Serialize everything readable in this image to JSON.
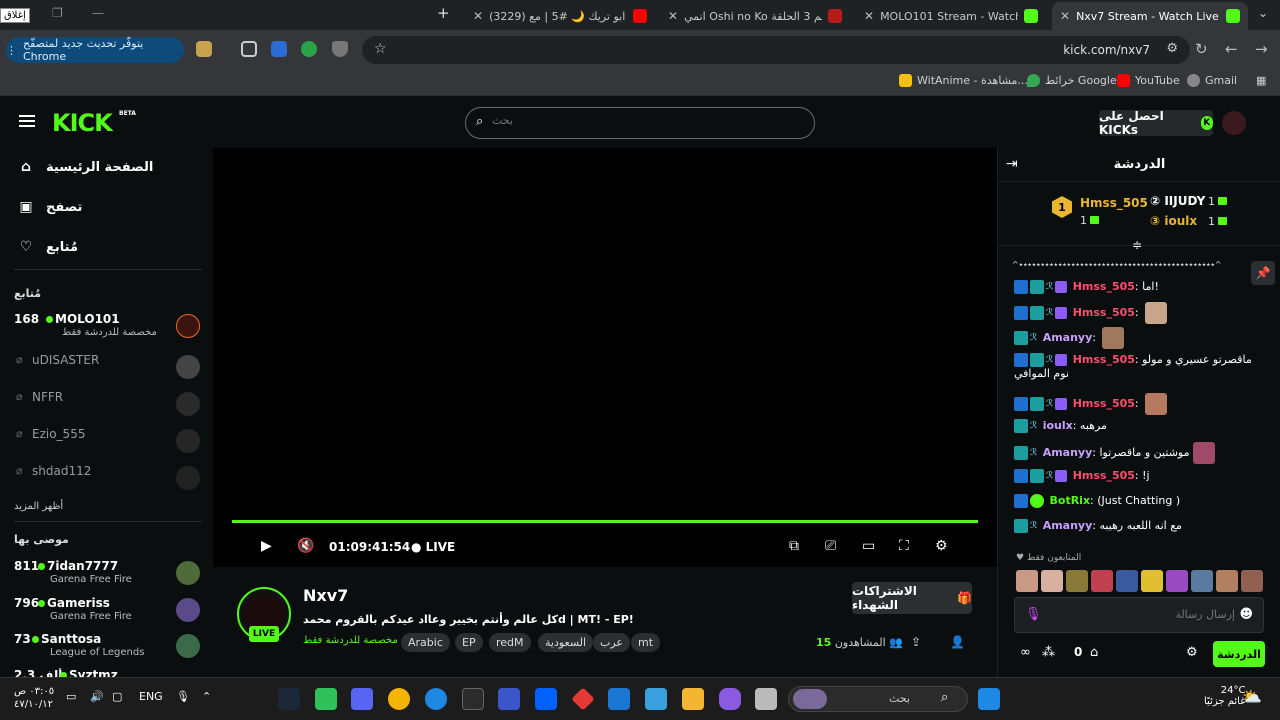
{
  "browser": {
    "tabs": [
      {
        "label": "Nxv7 Stream - Watch Live on Kick",
        "active": true,
        "color": "#53fc18"
      },
      {
        "label": "MOLO101 Stream - Watch Live",
        "color": "#53fc18"
      },
      {
        "label": "انمي Oshi no Ko الموسم 3 الحلقة",
        "color": "#e53935"
      },
      {
        "label": "(3229) سمرة ابو تريك 🌙 #5 | مع",
        "color": "#ff0000"
      }
    ],
    "close_tooltip": "إغلاق",
    "update_pill": "يتوفّر تحديث جديد لمتصفّح Chrome",
    "url": "kick.com/nxv7",
    "bookmarks": [
      {
        "label": "Gmail",
        "color": "#ea4335"
      },
      {
        "label": "YouTube",
        "color": "#ff0000"
      },
      {
        "label": "خرائط Google",
        "color": "#34a853"
      },
      {
        "label": "WitAnime - مشاهدة...",
        "color": "#f4c20d"
      }
    ]
  },
  "kick": {
    "logo": "KICK",
    "beta": "BETA",
    "search_placeholder": "بحث",
    "get_kicks": "احصل على KICKs",
    "nav": [
      {
        "label": "الصفحة الرئيسية",
        "icon": "home-icon"
      },
      {
        "label": "تصفح",
        "icon": "browse-icon"
      },
      {
        "label": "مُتابع",
        "icon": "heart-icon"
      }
    ],
    "following_title": "مُتابع",
    "following": [
      {
        "name": "MOLO101",
        "count": "168",
        "sub": "مخصصة للدردشة فقط",
        "live": true
      },
      {
        "name": "uDISASTER",
        "live": false
      },
      {
        "name": "NFFR",
        "live": false
      },
      {
        "name": "Ezio_555",
        "live": false
      },
      {
        "name": "shdad112",
        "live": false
      }
    ],
    "show_more": "أظهر المزيد",
    "recommended_title": "موصى بها",
    "recommended": [
      {
        "name": "7idan7777",
        "count": "811",
        "sub": "Garena Free Fire"
      },
      {
        "name": "Gameriss",
        "count": "796",
        "sub": "Garena Free Fire"
      },
      {
        "name": "Santtosa",
        "count": "73",
        "sub": "League of Legends"
      },
      {
        "name": "Syztmz",
        "count": "2.3 ألف",
        "sub": ""
      }
    ],
    "player": {
      "time": "01:09:41:54",
      "live": "LIVE",
      "progress": 1.0
    },
    "stream": {
      "streamer": "Nxv7",
      "live_badge": "LIVE",
      "title": "كل عالم وأنتم بخيير وعااد عيدكم بالقروم محمدd | MT! - EP!",
      "category": "مخصصة للدردشة فقط",
      "tags": [
        "Arabic",
        "EP",
        "redM",
        "السعودية",
        "عرب",
        "mt"
      ],
      "subs_button": "الاشتراكات الشهداء",
      "viewers_label": "المشاهدون",
      "viewers": "15"
    },
    "chat": {
      "header": "الدردشة",
      "leaderboard": [
        {
          "rank": "1",
          "name": "Hmss_505",
          "count": "1",
          "color": "#e8b630"
        },
        {
          "rank": "2",
          "name": "IIJUDY",
          "count": "1",
          "color": "#ffffff"
        },
        {
          "rank": "3",
          "name": "ioulx",
          "count": "1",
          "color": "#e8b630"
        }
      ],
      "pinned_line": "^٭٭٭٭٭٭٭٭٭٭٭٭٭٭٭٭٭٭٭٭٭٭٭٭٭٭٭٭٭٭٭٭٭٭٭٭٭٭٭٭٭٭٭٭٭^",
      "messages": [
        {
          "user": "Hmss_505",
          "color": "#ff4d6d",
          "text": "اما!",
          "mod": true,
          "og": true,
          "gift": true,
          "emote": false
        },
        {
          "user": "Hmss_505",
          "color": "#ff4d6d",
          "text": "",
          "mod": true,
          "og": true,
          "gift": true,
          "emote": true
        },
        {
          "user": "Amanyy",
          "color": "#c8a0ff",
          "text": "",
          "mod": false,
          "og": true,
          "gift": false,
          "emote": true
        },
        {
          "user": "Hmss_505",
          "color": "#ff4d6d",
          "text": "ماقصرتو عسيري و مولو نوم الموافي",
          "mod": true,
          "og": true,
          "gift": true,
          "emote": false
        },
        {
          "user": "Hmss_505",
          "color": "#ff4d6d",
          "text": "",
          "mod": true,
          "og": true,
          "gift": true,
          "emote": true
        },
        {
          "user": "ioulx",
          "color": "#c8a0ff",
          "text": "مرهبه",
          "mod": false,
          "og": true,
          "gift": false,
          "emote": false
        },
        {
          "user": "Amanyy",
          "color": "#c8a0ff",
          "text": "موشتين و ماقصرتوا",
          "mod": false,
          "og": true,
          "gift": false,
          "emote": true
        },
        {
          "user": "Hmss_505",
          "color": "#ff4d6d",
          "text": "!j",
          "mod": true,
          "og": true,
          "gift": true,
          "emote": false
        },
        {
          "user": "BotRix",
          "color": "#53fc18",
          "text": "(Just Chatting )",
          "mod": true,
          "og": false,
          "gift": false,
          "verified": true,
          "emote": false
        },
        {
          "user": "Amanyy",
          "color": "#c8a0ff",
          "text": "مع انه اللعبه رهيبه",
          "mod": false,
          "og": true,
          "gift": false,
          "emote": false
        }
      ],
      "followers_only": "المتابعون فقط",
      "input_placeholder": "إرسال رسالة",
      "send_button": "الدردشة",
      "points": "0"
    }
  },
  "taskbar": {
    "search_placeholder": "بحث",
    "weather_temp": "24°C",
    "weather_desc": "غائم جزئيًا",
    "lang": "ENG",
    "time": "٠٣:٠٥ ص",
    "date": "٤٧/١٠/١٢"
  }
}
